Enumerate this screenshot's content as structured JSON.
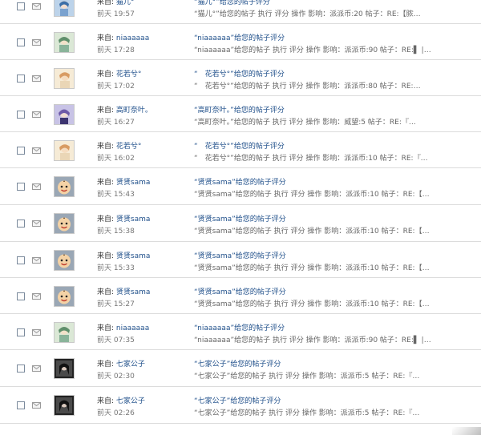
{
  "messages": [
    {
      "from_label": "来自:",
      "from_name": "猫儿°",
      "time": "前天 19:57",
      "title": "“猫儿°”给您的帖子评分",
      "desc": "“猫儿°”给您的帖子 执行 评分 操作 影响：派派币:20 帖子：RE:【脓…",
      "avatar": "blue"
    },
    {
      "from_label": "来自:",
      "from_name": "niaaaaaa",
      "time": "前天 17:28",
      "title": "“niaaaaaa”给您的帖子评分",
      "desc": "“niaaaaaa”给您的帖子 执行 评分 操作 影响：派派币:90 帖子：RE:▌ |…",
      "avatar": "green"
    },
    {
      "from_label": "来自:",
      "from_name": "花若兮°",
      "time": "前天 17:02",
      "title": "“　花若兮°”给您的帖子评分",
      "desc": "“　花若兮°”给您的帖子 执行 评分 操作 影响：派派币:80 帖子：RE:…",
      "avatar": "peach"
    },
    {
      "from_label": "来自:",
      "from_name": "高町奈叶。",
      "time": "前天 16:27",
      "title": "“高町奈叶。”给您的帖子评分",
      "desc": "“高町奈叶。”给您的帖子 执行 评分 操作 影响：威望:5 帖子：RE:『…",
      "avatar": "purple"
    },
    {
      "from_label": "来自:",
      "from_name": "花若兮°",
      "time": "前天 16:02",
      "title": "“　花若兮°”给您的帖子评分",
      "desc": "“　花若兮°”给您的帖子 执行 评分 操作 影响：派派币:10 帖子：RE:『…",
      "avatar": "peach"
    },
    {
      "from_label": "来自:",
      "from_name": "贤贤sama",
      "time": "前天 15:43",
      "title": "“贤贤sama”给您的帖子评分",
      "desc": "“贤贤sama”给您的帖子 执行 评分 操作 影响：派派币:10 帖子：RE:【…",
      "avatar": "egg"
    },
    {
      "from_label": "来自:",
      "from_name": "贤贤sama",
      "time": "前天 15:38",
      "title": "“贤贤sama”给您的帖子评分",
      "desc": "“贤贤sama”给您的帖子 执行 评分 操作 影响：派派币:10 帖子：RE:【…",
      "avatar": "egg"
    },
    {
      "from_label": "来自:",
      "from_name": "贤贤sama",
      "time": "前天 15:33",
      "title": "“贤贤sama”给您的帖子评分",
      "desc": "“贤贤sama”给您的帖子 执行 评分 操作 影响：派派币:10 帖子：RE:【…",
      "avatar": "egg"
    },
    {
      "from_label": "来自:",
      "from_name": "贤贤sama",
      "time": "前天 15:27",
      "title": "“贤贤sama”给您的帖子评分",
      "desc": "“贤贤sama”给您的帖子 执行 评分 操作 影响：派派币:10 帖子：RE:【…",
      "avatar": "egg"
    },
    {
      "from_label": "来自:",
      "from_name": "niaaaaaa",
      "time": "前天 07:35",
      "title": "“niaaaaaa”给您的帖子评分",
      "desc": "“niaaaaaa”给您的帖子 执行 评分 操作 影响：派派币:90 帖子：RE:▌ |…",
      "avatar": "green"
    },
    {
      "from_label": "来自:",
      "from_name": "七家公子",
      "time": "前天 02:30",
      "title": "“七家公子”给您的帖子评分",
      "desc": "“七家公子”给您的帖子 执行 评分 操作 影响：派派币:5 帖子：RE:『…",
      "avatar": "dark"
    },
    {
      "from_label": "来自:",
      "from_name": "七家公子",
      "time": "前天 02:26",
      "title": "“七家公子”给您的帖子评分",
      "desc": "“七家公子”给您的帖子 执行 评分 操作 影响：派派币:5 帖子：RE:『…",
      "avatar": "dark"
    }
  ],
  "icons": {
    "checkbox": "checkbox-icon",
    "envelope": "envelope-icon"
  },
  "colors": {
    "link": "#1f4f8a",
    "meta": "#777777",
    "divider": "#dcdcdc"
  }
}
